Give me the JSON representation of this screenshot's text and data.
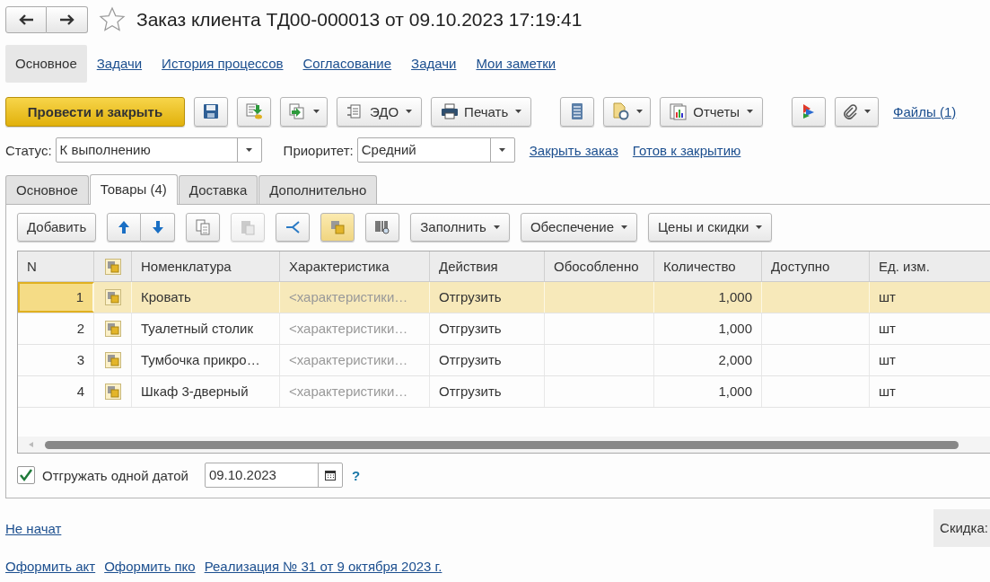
{
  "window": {
    "title": "Заказ клиента ТД00-000013 от 09.10.2023 17:19:41"
  },
  "nav": [
    {
      "label": "Основное",
      "selected": true
    },
    {
      "label": "Задачи",
      "selected": false
    },
    {
      "label": "История процессов",
      "selected": false
    },
    {
      "label": "Согласование",
      "selected": false
    },
    {
      "label": "Задачи",
      "selected": false
    },
    {
      "label": "Мои заметки",
      "selected": false
    }
  ],
  "toolbar": {
    "post_and_close": "Провести и закрыть",
    "edo": "ЭДО",
    "print": "Печать",
    "reports": "Отчеты",
    "files": "Файлы (1)"
  },
  "status": {
    "label": "Статус:",
    "value": "К выполнению"
  },
  "priority": {
    "label": "Приоритет:",
    "value": "Средний"
  },
  "actions": [
    "Закрыть заказ",
    "Готов к закрытию"
  ],
  "tabs": [
    {
      "label": "Основное",
      "selected": false
    },
    {
      "label": "Товары (4)",
      "selected": true
    },
    {
      "label": "Доставка",
      "selected": false
    },
    {
      "label": "Дополнительно",
      "selected": false
    }
  ],
  "table_toolbar": {
    "add": "Добавить",
    "fill": "Заполнить",
    "supply": "Обеспечение",
    "prices": "Цены и скидки"
  },
  "table": {
    "columns": [
      "N",
      "Номенклатура",
      "Характеристика",
      "Действия",
      "Обособленно",
      "Количество",
      "Доступно",
      "Ед. изм."
    ],
    "rows": [
      {
        "n": "1",
        "name": "Кровать",
        "characteristic": "<характеристики…",
        "action": "Отгрузить",
        "quantity": "1,000",
        "unit": "шт",
        "selected": true
      },
      {
        "n": "2",
        "name": "Туалетный столик",
        "characteristic": "<характеристики…",
        "action": "Отгрузить",
        "quantity": "1,000",
        "unit": "шт",
        "selected": false
      },
      {
        "n": "3",
        "name": "Тумбочка прикро…",
        "characteristic": "<характеристики…",
        "action": "Отгрузить",
        "quantity": "2,000",
        "unit": "шт",
        "selected": false
      },
      {
        "n": "4",
        "name": "Шкаф 3-дверный",
        "characteristic": "<характеристики…",
        "action": "Отгрузить",
        "quantity": "1,000",
        "unit": "шт",
        "selected": false
      }
    ]
  },
  "ship_one_date": {
    "label": "Отгружать одной датой",
    "checked": true,
    "date": "09.10.2023",
    "help": "?"
  },
  "state_link": "Не начат",
  "discount_label": "Скидка:",
  "footer_links": [
    "Оформить акт",
    "Оформить пко",
    "Реализация № 31 от 9 октября 2023 г."
  ]
}
